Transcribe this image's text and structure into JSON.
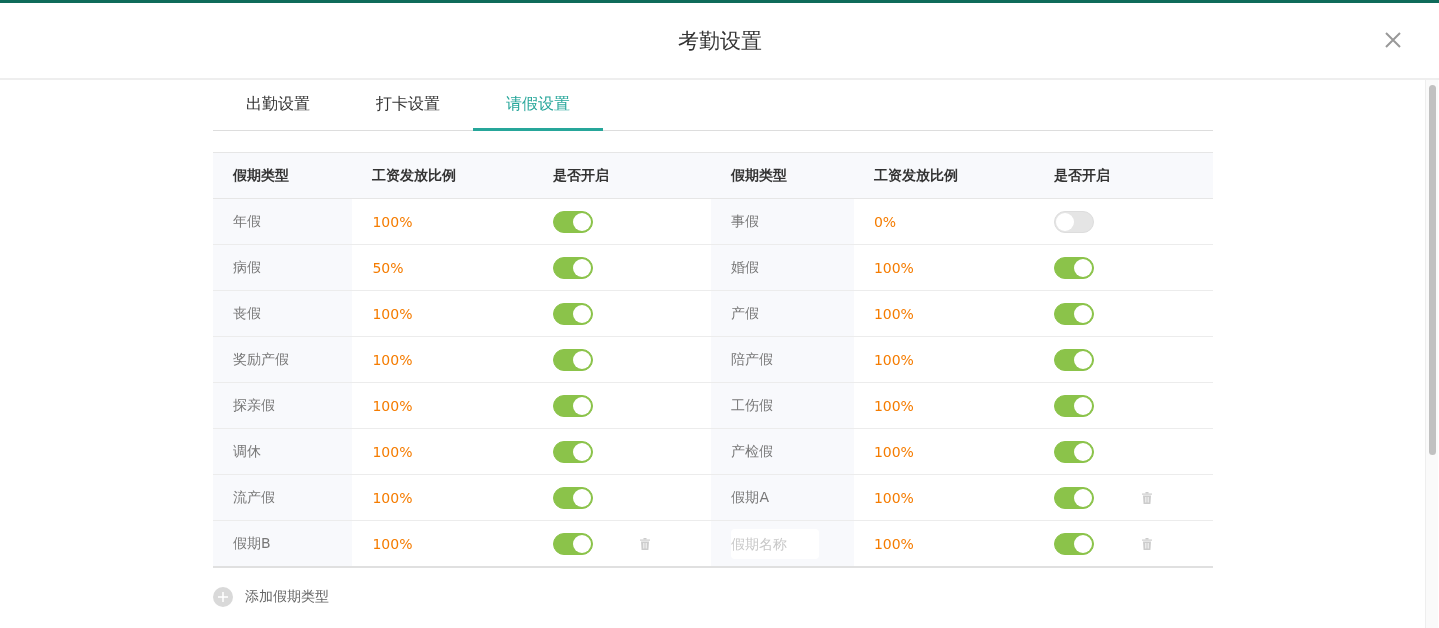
{
  "window": {
    "title": "考勤设置"
  },
  "tabs": [
    {
      "label": "出勤设置",
      "selected": false
    },
    {
      "label": "打卡设置",
      "selected": false
    },
    {
      "label": "请假设置",
      "selected": true
    }
  ],
  "table": {
    "columns": [
      "假期类型",
      "工资发放比例",
      "是否开启",
      "假期类型",
      "工资发放比例",
      "是否开启"
    ],
    "rows": [
      [
        {
          "kind": "fixed",
          "name": "年假",
          "rate": "100%",
          "on": true
        },
        {
          "kind": "fixed",
          "name": "事假",
          "rate": "0%",
          "on": false
        }
      ],
      [
        {
          "kind": "fixed",
          "name": "病假",
          "rate": "50%",
          "on": true
        },
        {
          "kind": "fixed",
          "name": "婚假",
          "rate": "100%",
          "on": true
        }
      ],
      [
        {
          "kind": "fixed",
          "name": "丧假",
          "rate": "100%",
          "on": true
        },
        {
          "kind": "fixed",
          "name": "产假",
          "rate": "100%",
          "on": true
        }
      ],
      [
        {
          "kind": "fixed",
          "name": "奖励产假",
          "rate": "100%",
          "on": true
        },
        {
          "kind": "fixed",
          "name": "陪产假",
          "rate": "100%",
          "on": true
        }
      ],
      [
        {
          "kind": "fixed",
          "name": "探亲假",
          "rate": "100%",
          "on": true
        },
        {
          "kind": "fixed",
          "name": "工伤假",
          "rate": "100%",
          "on": true
        }
      ],
      [
        {
          "kind": "fixed",
          "name": "调休",
          "rate": "100%",
          "on": true
        },
        {
          "kind": "fixed",
          "name": "产检假",
          "rate": "100%",
          "on": true
        }
      ],
      [
        {
          "kind": "fixed",
          "name": "流产假",
          "rate": "100%",
          "on": true
        },
        {
          "kind": "custom",
          "name": "假期A",
          "rate": "100%",
          "on": true
        }
      ],
      [
        {
          "kind": "custom",
          "name": "假期B",
          "rate": "100%",
          "on": true
        },
        {
          "kind": "new",
          "placeholder": "假期名称",
          "rate": "100%",
          "on": true
        }
      ]
    ]
  },
  "add_button": {
    "label": "添加假期类型"
  }
}
